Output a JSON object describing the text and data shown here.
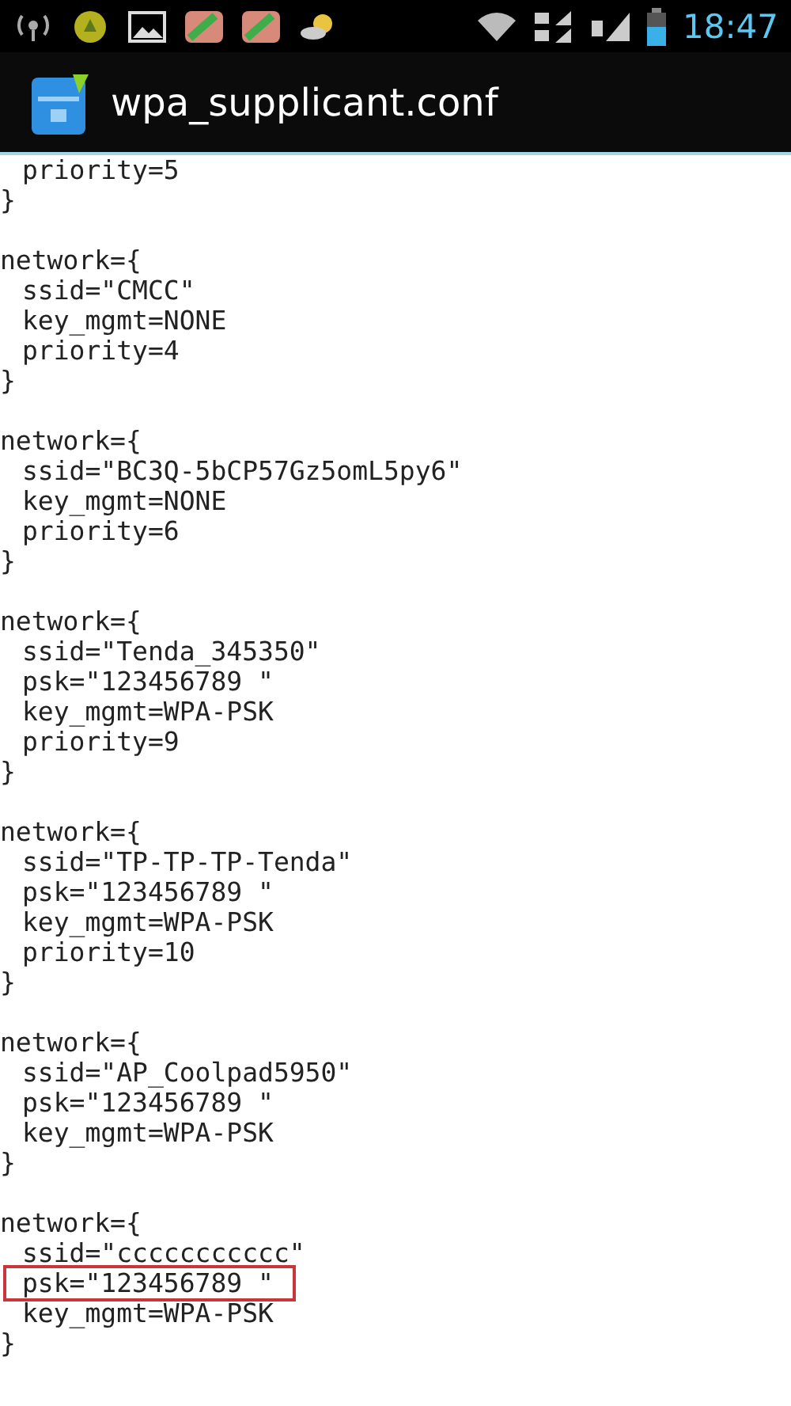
{
  "status_bar": {
    "time": "18:47"
  },
  "window": {
    "title": "wpa_supplicant.conf"
  },
  "blocks": [
    {
      "entries": [
        {
          "text": "priority=5",
          "highlighted": false
        }
      ],
      "closer": "}"
    },
    {
      "opener": "network={",
      "entries": [
        {
          "text": "ssid=\"CMCC\"",
          "highlighted": false
        },
        {
          "text": "key_mgmt=NONE",
          "highlighted": false
        },
        {
          "text": "priority=4",
          "highlighted": false
        }
      ],
      "closer": "}"
    },
    {
      "opener": "network={",
      "entries": [
        {
          "text": "ssid=\"BC3Q-5bCP57Gz5omL5py6\"",
          "highlighted": false
        },
        {
          "text": "key_mgmt=NONE",
          "highlighted": false
        },
        {
          "text": "priority=6",
          "highlighted": false
        }
      ],
      "closer": "}"
    },
    {
      "opener": "network={",
      "entries": [
        {
          "text": "ssid=\"Tenda_345350\"",
          "highlighted": false
        },
        {
          "text": "psk=\"123456789 \"",
          "highlighted": false
        },
        {
          "text": "key_mgmt=WPA-PSK",
          "highlighted": false
        },
        {
          "text": "priority=9",
          "highlighted": false
        }
      ],
      "closer": "}"
    },
    {
      "opener": "network={",
      "entries": [
        {
          "text": "ssid=\"TP-TP-TP-Tenda\"",
          "highlighted": false
        },
        {
          "text": "psk=\"123456789 \"",
          "highlighted": false
        },
        {
          "text": "key_mgmt=WPA-PSK",
          "highlighted": false
        },
        {
          "text": "priority=10",
          "highlighted": false
        }
      ],
      "closer": "}"
    },
    {
      "opener": "network={",
      "entries": [
        {
          "text": "ssid=\"AP_Coolpad5950\"",
          "highlighted": false
        },
        {
          "text": "psk=\"123456789 \"",
          "highlighted": false
        },
        {
          "text": "key_mgmt=WPA-PSK",
          "highlighted": false
        }
      ],
      "closer": "}"
    },
    {
      "opener": "network={",
      "entries": [
        {
          "text": "ssid=\"ccccccccccc\"",
          "highlighted": false
        },
        {
          "text": "psk=\"123456789 \"",
          "highlighted": true
        },
        {
          "text": "key_mgmt=WPA-PSK",
          "highlighted": false
        }
      ],
      "closer": "}"
    }
  ]
}
